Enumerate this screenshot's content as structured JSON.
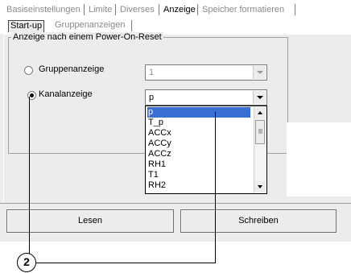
{
  "tabs": {
    "items": [
      {
        "label": "Basiseinstellungen",
        "active": false
      },
      {
        "label": "Limite",
        "active": false
      },
      {
        "label": "Diverses",
        "active": false
      },
      {
        "label": "Anzeige",
        "active": true
      },
      {
        "label": "Speicher formatieren",
        "active": false
      }
    ]
  },
  "subtabs": {
    "items": [
      {
        "label": "Start-up",
        "active": true
      },
      {
        "label": "Gruppenanzeigen",
        "active": false
      }
    ]
  },
  "group": {
    "title": "Anzeige nach einem Power-On-Reset",
    "option1": {
      "label": "Gruppenanzeige",
      "selected": false,
      "value": "1"
    },
    "option2": {
      "label": "Kanalanzeige",
      "selected": true,
      "value": "p"
    }
  },
  "dropdown": {
    "items": [
      "p",
      "T_p",
      "ACCx",
      "ACCy",
      "ACCz",
      "RH1",
      "T1",
      "RH2"
    ],
    "selected_index": 0
  },
  "buttons": {
    "read": "Lesen",
    "write": "Schreiben"
  },
  "callout": {
    "number": "2"
  },
  "colors": {
    "selection": "#3b6ed3",
    "window_bg": "#ececec",
    "disabled_text": "#8a8a8a"
  }
}
